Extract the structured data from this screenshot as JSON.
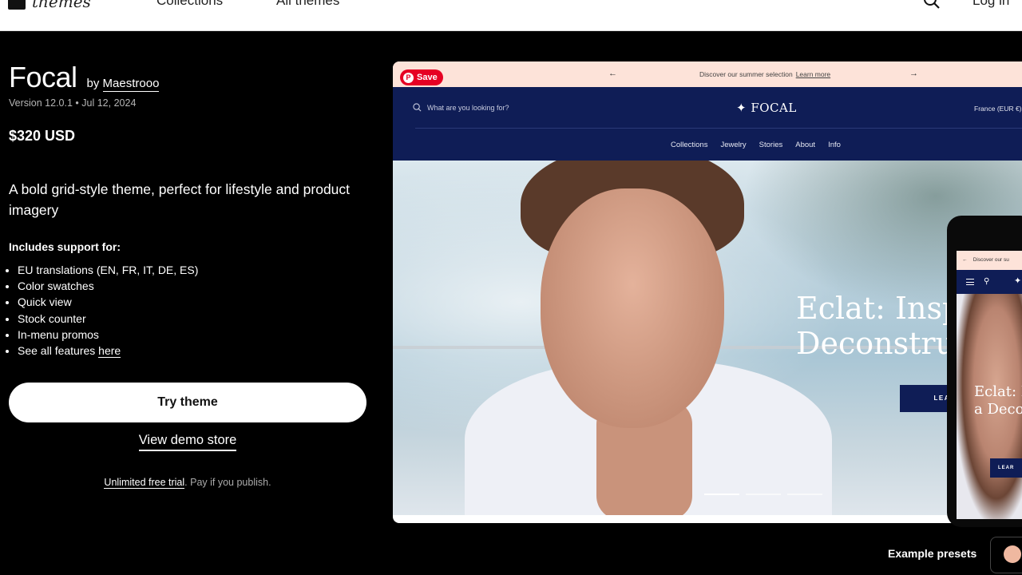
{
  "topnav": {
    "logo_text": "themes",
    "links": [
      "Collections",
      "All themes"
    ],
    "login": "Log in"
  },
  "theme": {
    "name": "Focal",
    "by_prefix": "by",
    "author": "Maestrooo",
    "version": "Version 12.0.1",
    "separator": "•",
    "date": "Jul 12, 2024",
    "price": "$320 USD",
    "tagline": "A bold grid-style theme, perfect for lifestyle and product imagery",
    "support_heading": "Includes support for:",
    "features": [
      "EU translations (EN, FR, IT, DE, ES)",
      "Color swatches",
      "Quick view",
      "Stock counter",
      "In-menu promos"
    ],
    "features_more_prefix": "See all features ",
    "features_more_link": "here",
    "try_button": "Try theme",
    "demo_link": "View demo store",
    "trial_link": "Unlimited free trial",
    "trial_suffix": ". Pay if you publish."
  },
  "preview": {
    "pinterest_save": "Save",
    "announcement": "Discover our summer selection",
    "announcement_link": "Learn more",
    "search_placeholder": "What are you looking for?",
    "store_logo": "✦ FOCAL",
    "country": "France (EUR €)",
    "nav": [
      "Collections",
      "Jewelry",
      "Stories",
      "About",
      "Info"
    ],
    "hero_title_line1": "Eclat: Insp",
    "hero_title_line2": "Deconstru",
    "hero_button": "LEARN M",
    "slides": 3,
    "active_slide": 1,
    "mobile": {
      "announcement": "Discover our su",
      "logo": "✦",
      "hero_title_line1": "Eclat: I",
      "hero_title_line2": "a Deco",
      "hero_button": "LEAR"
    }
  },
  "presets": {
    "label": "Example presets",
    "swatch_color": "#efb8a0"
  },
  "colors": {
    "store_navy": "#0f1d56",
    "announcement_bg": "#fde3d9",
    "pinterest_red": "#e60023"
  }
}
